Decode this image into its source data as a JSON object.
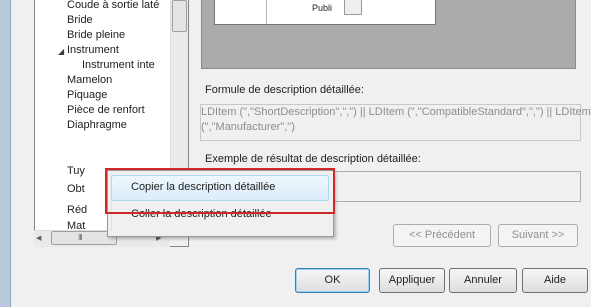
{
  "tree": {
    "items": [
      {
        "label": "Coude à sortie laté",
        "level": 1
      },
      {
        "label": "Bride",
        "level": 1
      },
      {
        "label": "Bride pleine",
        "level": 1
      },
      {
        "label": "Instrument",
        "level": 0,
        "expanded": true
      },
      {
        "label": "Instrument inte",
        "level": 2
      },
      {
        "label": "Mamelon",
        "level": 1
      },
      {
        "label": "Piquage",
        "level": 1
      },
      {
        "label": "Pièce de renfort",
        "level": 1
      },
      {
        "label": "Diaphragme",
        "level": 1
      },
      {
        "label": "Tuy",
        "level": 1
      },
      {
        "label": "Obt",
        "level": 1
      },
      {
        "label": "Réd",
        "level": 1
      },
      {
        "label": "Mat",
        "level": 1
      }
    ],
    "hscroll_grip": "III"
  },
  "preview": {
    "text": "Publi"
  },
  "formula": {
    "label": "Formule de description détaillée:",
    "line1": "LDItem (\",\"ShortDescription\",\",\") || LDItem (\",\"CompatibleStandard\",\",\") || LDItem",
    "line2": "(\",\"Manufacturer\",\")"
  },
  "example": {
    "label": "Exemple de résultat de description détaillée:",
    "value": ""
  },
  "nav": {
    "prev": "<< Précédent",
    "next": "Suivant >>"
  },
  "buttons": {
    "ok": "OK",
    "apply": "Appliquer",
    "cancel": "Annuler",
    "help": "Aide"
  },
  "context_menu": {
    "items": [
      {
        "label": "Copier la description détaillée",
        "hovered": true
      },
      {
        "label": "Coller la description détaillée",
        "hovered": false
      }
    ]
  },
  "colors": {
    "highlight": "#cc2a2a",
    "hover_border": "#a8d8eb"
  }
}
